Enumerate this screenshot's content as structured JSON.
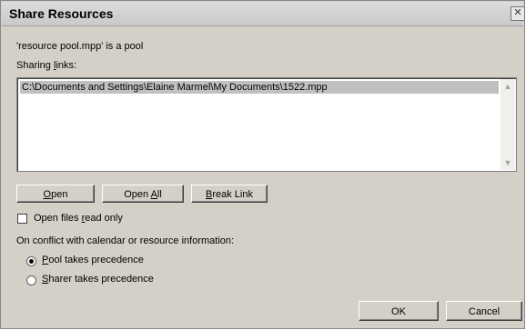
{
  "window": {
    "title": "Share Resources",
    "close_glyph": "✕"
  },
  "info": {
    "pool_status": "'resource pool.mpp' is a pool",
    "sharing_links_label": "Sharing links:"
  },
  "links": [
    "C:\\Documents and Settings\\Elaine Marmel\\My Documents\\1522.mpp"
  ],
  "buttons": {
    "open": "Open",
    "open_all": "Open All",
    "break_link": "Break Link",
    "ok": "OK",
    "cancel": "Cancel"
  },
  "options": {
    "read_only_label": "Open files read only",
    "read_only_checked": false,
    "conflict_label": "On conflict with calendar or resource information:",
    "pool_precedence_label": "Pool takes precedence",
    "sharer_precedence_label": "Sharer takes precedence",
    "selected": "pool"
  }
}
